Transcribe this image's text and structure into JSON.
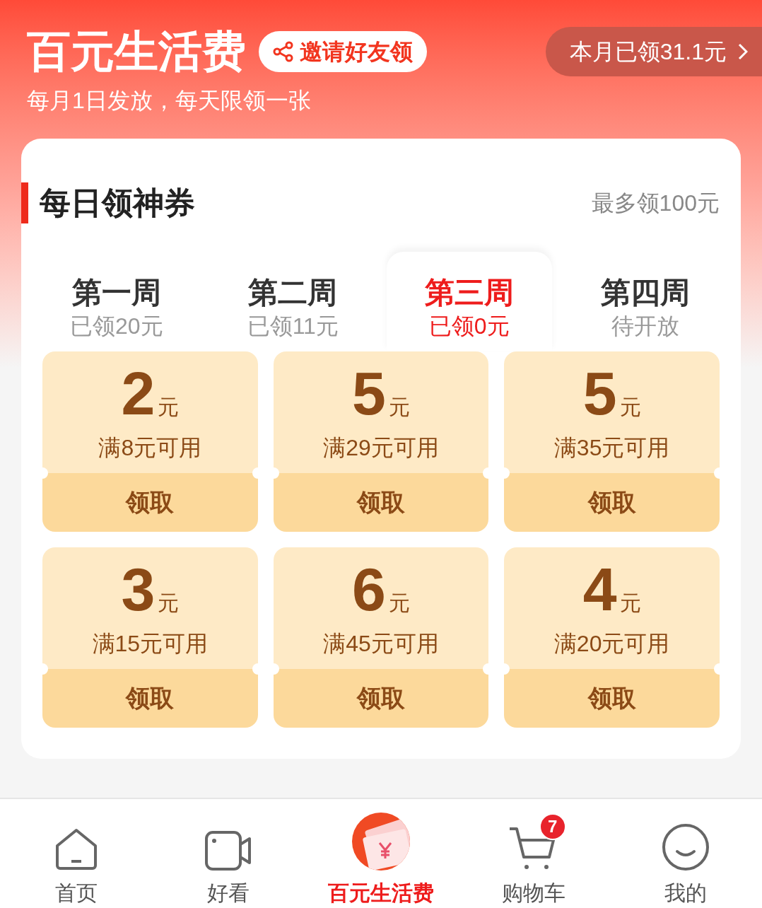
{
  "header": {
    "title": "百元生活费",
    "invite_button": "邀请好友领",
    "monthly_button": "本月已领31.1元",
    "subtitle": "每月1日发放，每天限领一张"
  },
  "section": {
    "title": "每日领神券",
    "note": "最多领100元"
  },
  "weeks": [
    {
      "label": "第一周",
      "status": "已领20元",
      "selected": false
    },
    {
      "label": "第二周",
      "status": "已领11元",
      "selected": false
    },
    {
      "label": "第三周",
      "status": "已领0元",
      "selected": true
    },
    {
      "label": "第四周",
      "status": "待开放",
      "selected": false
    }
  ],
  "coupons": [
    {
      "amount": "2",
      "unit": "元",
      "condition": "满8元可用",
      "action": "领取"
    },
    {
      "amount": "5",
      "unit": "元",
      "condition": "满29元可用",
      "action": "领取"
    },
    {
      "amount": "5",
      "unit": "元",
      "condition": "满35元可用",
      "action": "领取"
    },
    {
      "amount": "3",
      "unit": "元",
      "condition": "满15元可用",
      "action": "领取"
    },
    {
      "amount": "6",
      "unit": "元",
      "condition": "满45元可用",
      "action": "领取"
    },
    {
      "amount": "4",
      "unit": "元",
      "condition": "满20元可用",
      "action": "领取"
    }
  ],
  "nav": [
    {
      "kind": "home",
      "label": "首页",
      "selected": false
    },
    {
      "kind": "video",
      "label": "好看",
      "selected": false
    },
    {
      "kind": "money",
      "label": "百元生活费",
      "selected": true
    },
    {
      "kind": "cart",
      "label": "购物车",
      "selected": false,
      "badge": "7"
    },
    {
      "kind": "me",
      "label": "我的",
      "selected": false
    }
  ]
}
